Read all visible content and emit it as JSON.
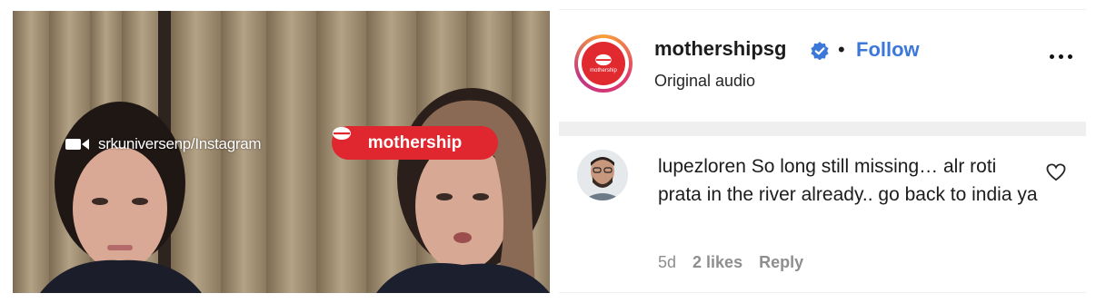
{
  "video": {
    "watermark": "srkuniversenp/Instagram",
    "badge": "mothership",
    "camera_icon": "video-camera-icon"
  },
  "post": {
    "username": "mothershipsg",
    "separator": "•",
    "follow_label": "Follow",
    "audio": "Original audio",
    "avatar_text": "mothership"
  },
  "comment": {
    "username": "lupezloren",
    "text": "So long still missing… alr roti prata in the river already.. go back to india ya",
    "time": "5d",
    "likes": "2 likes",
    "reply": "Reply"
  },
  "colors": {
    "brand_red": "#e0262e",
    "follow_blue": "#3c78d8",
    "verified_blue": "#3c78d8"
  }
}
